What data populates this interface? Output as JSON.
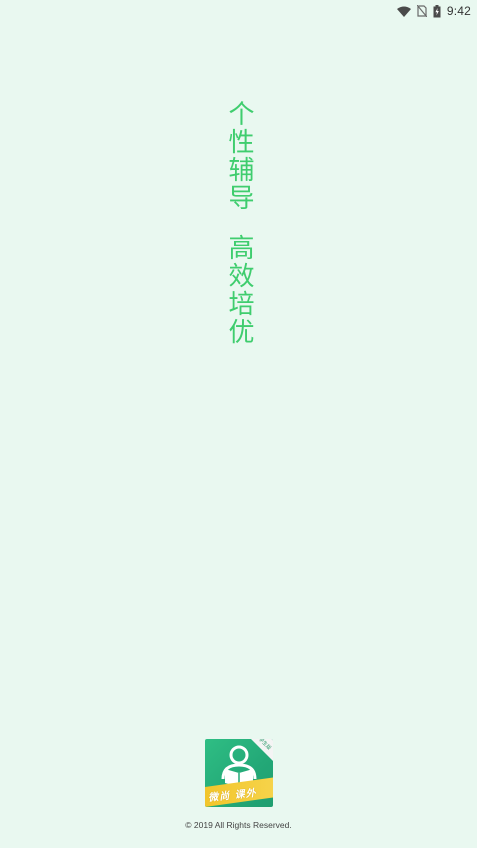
{
  "status_bar": {
    "time": "9:42",
    "icons": [
      "wifi-icon",
      "no-sim-icon",
      "battery-charging-icon"
    ]
  },
  "slogan": {
    "line1": "个性辅导",
    "line2": "高效培优",
    "color": "#3fcd6e"
  },
  "logo": {
    "banner_text": "微尚 课外",
    "corner_text": "学生版",
    "primary_color": "#23a877",
    "banner_color": "#f2c52a"
  },
  "footer": {
    "copyright": "© 2019 All Rights Reserved."
  },
  "background_color": "#e9f8f0"
}
